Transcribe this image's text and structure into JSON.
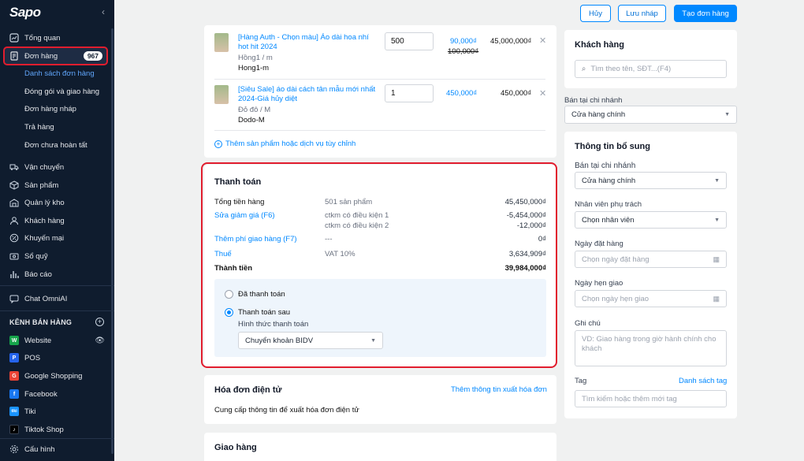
{
  "sidebar": {
    "logo": "Sapo",
    "collapse_icon": "chevron-left-icon",
    "nav": [
      {
        "label": "Tổng quan",
        "icon": "dashboard-icon"
      },
      {
        "label": "Đơn hàng",
        "icon": "order-icon",
        "badge": "967"
      },
      {
        "label": "Vận chuyển",
        "icon": "truck-icon"
      },
      {
        "label": "Sản phẩm",
        "icon": "box-icon"
      },
      {
        "label": "Quản lý kho",
        "icon": "warehouse-icon"
      },
      {
        "label": "Khách hàng",
        "icon": "user-icon"
      },
      {
        "label": "Khuyến mại",
        "icon": "discount-icon"
      },
      {
        "label": "Sổ quỹ",
        "icon": "cashbook-icon"
      },
      {
        "label": "Báo cáo",
        "icon": "chart-icon"
      },
      {
        "label": "Chat OmniAI",
        "icon": "chat-icon"
      }
    ],
    "sub": [
      "Danh sách đơn hàng",
      "Đóng gói và giao hàng",
      "Đơn hàng nháp",
      "Trả hàng",
      "Đơn chưa hoàn tất"
    ],
    "channels_title": "KÊNH BÁN HÀNG",
    "channels": [
      {
        "label": "Website",
        "color": "#16a34a",
        "glyph": "W"
      },
      {
        "label": "POS",
        "color": "#2563eb",
        "glyph": "P"
      },
      {
        "label": "Google Shopping",
        "color": "#ea4335",
        "glyph": "G"
      },
      {
        "label": "Facebook",
        "color": "#1877f2",
        "glyph": "f"
      },
      {
        "label": "Tiki",
        "color": "#1a94ff",
        "glyph": "tiki"
      },
      {
        "label": "Tiktok Shop",
        "color": "#000000",
        "glyph": "♪"
      }
    ],
    "settings": "Cấu hình"
  },
  "toolbar": {
    "cancel": "Hủy",
    "save_draft": "Lưu nháp",
    "create": "Tạo đơn hàng"
  },
  "products": [
    {
      "name": "[Hàng Auth - Chọn màu] Áo dài hoa nhí hot hit 2024",
      "variant": "Hồng1 / m",
      "sku": "Hong1-m",
      "qty": "500",
      "price": "90,000₫",
      "old_price": "100,000₫",
      "total": "45,000,000₫"
    },
    {
      "name": "[Siêu Sale] áo dài cách tân mẫu mới nhất 2024-Giá hủy diệt",
      "variant": "Đỏ đô / M",
      "sku": "Dodo-M",
      "qty": "1",
      "price": "450,000₫",
      "total": "450,000₫"
    }
  ],
  "add_product": "Thêm sản phẩm hoặc dịch vụ tùy chỉnh",
  "payment": {
    "title": "Thanh toán",
    "subtotal_label": "Tổng tiền hàng",
    "subtotal_count": "501 sản phẩm",
    "subtotal_value": "45,450,000₫",
    "discount_label": "Sửa giảm giá (F6)",
    "discount_1": "ctkm có điều kiện 1",
    "discount_1_value": "-5,454,000₫",
    "discount_2": "ctkm có điều kiện 2",
    "discount_2_value": "-12,000₫",
    "shipping_label": "Thêm phí giao hàng (F7)",
    "shipping_mid": "---",
    "shipping_value": "0₫",
    "tax_label": "Thuế",
    "tax_mid": "VAT 10%",
    "tax_value": "3,634,909₫",
    "total_label": "Thành tiền",
    "total_value": "39,984,000₫",
    "paid_option": "Đã thanh toán",
    "later_option": "Thanh toán sau",
    "method_label": "Hình thức thanh toán",
    "method_value": "Chuyển khoản BIDV"
  },
  "invoice": {
    "title": "Hóa đơn điện tử",
    "link": "Thêm thông tin xuất hóa đơn",
    "desc": "Cung cấp thông tin để xuất hóa đơn điện tử"
  },
  "shipping": {
    "title": "Giao hàng"
  },
  "customer": {
    "title": "Khách hàng",
    "placeholder": "Tìm theo tên, SĐT...(F4)"
  },
  "branch": {
    "label": "Bán tại chi nhánh",
    "value": "Cửa hàng chính"
  },
  "extra": {
    "title": "Thông tin bổ sung",
    "branch_label": "Bán tại chi nhánh",
    "branch_value": "Cửa hàng chính",
    "staff_label": "Nhân viên phụ trách",
    "staff_value": "Chọn nhân viên",
    "order_date_label": "Ngày đặt hàng",
    "order_date_ph": "Chọn ngày đặt hàng",
    "delivery_label": "Ngày hẹn giao",
    "delivery_ph": "Chọn ngày hẹn giao",
    "note_label": "Ghi chú",
    "note_ph": "VD: Giao hàng trong giờ hành chính cho khách",
    "tag_label": "Tag",
    "tag_link": "Danh sách tag",
    "tag_ph": "Tìm kiếm hoặc thêm mới tag"
  }
}
